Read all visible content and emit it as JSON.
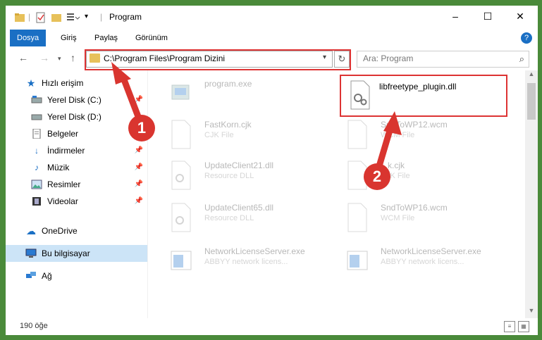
{
  "titlebar": {
    "title": "Program",
    "minimize": "–",
    "maximize": "☐",
    "close": "✕"
  },
  "ribbon": {
    "tabs": [
      "Dosya",
      "Giriş",
      "Paylaş",
      "Görünüm"
    ],
    "help": "?"
  },
  "address": {
    "path": "C:\\Program Files\\Program Dizini",
    "search_placeholder": "Ara: Program"
  },
  "sidebar": {
    "items": [
      {
        "label": "Hızlı erişim",
        "icon": "star-icon",
        "pinned": false
      },
      {
        "label": "Yerel Disk (C:)",
        "icon": "drive-icon",
        "pinned": true
      },
      {
        "label": "Yerel Disk (D:)",
        "icon": "drive-icon",
        "pinned": false
      },
      {
        "label": "Belgeler",
        "icon": "documents-icon",
        "pinned": true
      },
      {
        "label": "İndirmeler",
        "icon": "downloads-icon",
        "pinned": true
      },
      {
        "label": "Müzik",
        "icon": "music-icon",
        "pinned": true
      },
      {
        "label": "Resimler",
        "icon": "pictures-icon",
        "pinned": true
      },
      {
        "label": "Videolar",
        "icon": "videos-icon",
        "pinned": true
      },
      {
        "label": "OneDrive",
        "icon": "cloud-icon",
        "pinned": false
      },
      {
        "label": "Bu bilgisayar",
        "icon": "computer-icon",
        "pinned": false
      },
      {
        "label": "Ağ",
        "icon": "network-icon",
        "pinned": false
      }
    ]
  },
  "files": [
    {
      "name": "program.exe",
      "type": ""
    },
    {
      "name": "libfreetype_plugin.dll",
      "type": ""
    },
    {
      "name": "FastKorn.cjk",
      "type": "CJK File"
    },
    {
      "name": "SndToWP12.wcm",
      "type": "WCM File"
    },
    {
      "name": "UpdateClient21.dll",
      "type": "Resource DLL"
    },
    {
      "name": "...k.cjk",
      "type": "CJK File"
    },
    {
      "name": "UpdateClient65.dll",
      "type": "Resource DLL"
    },
    {
      "name": "SndToWP16.wcm",
      "type": "WCM File"
    },
    {
      "name": "NetworkLicenseServer.exe",
      "type": "ABBYY network licens..."
    },
    {
      "name": "NetworkLicenseServer.exe",
      "type": "ABBYY network licens..."
    }
  ],
  "status": {
    "count": "190 öğe"
  },
  "annotations": {
    "step1": "1",
    "step2": "2",
    "color": "#d9352f"
  }
}
